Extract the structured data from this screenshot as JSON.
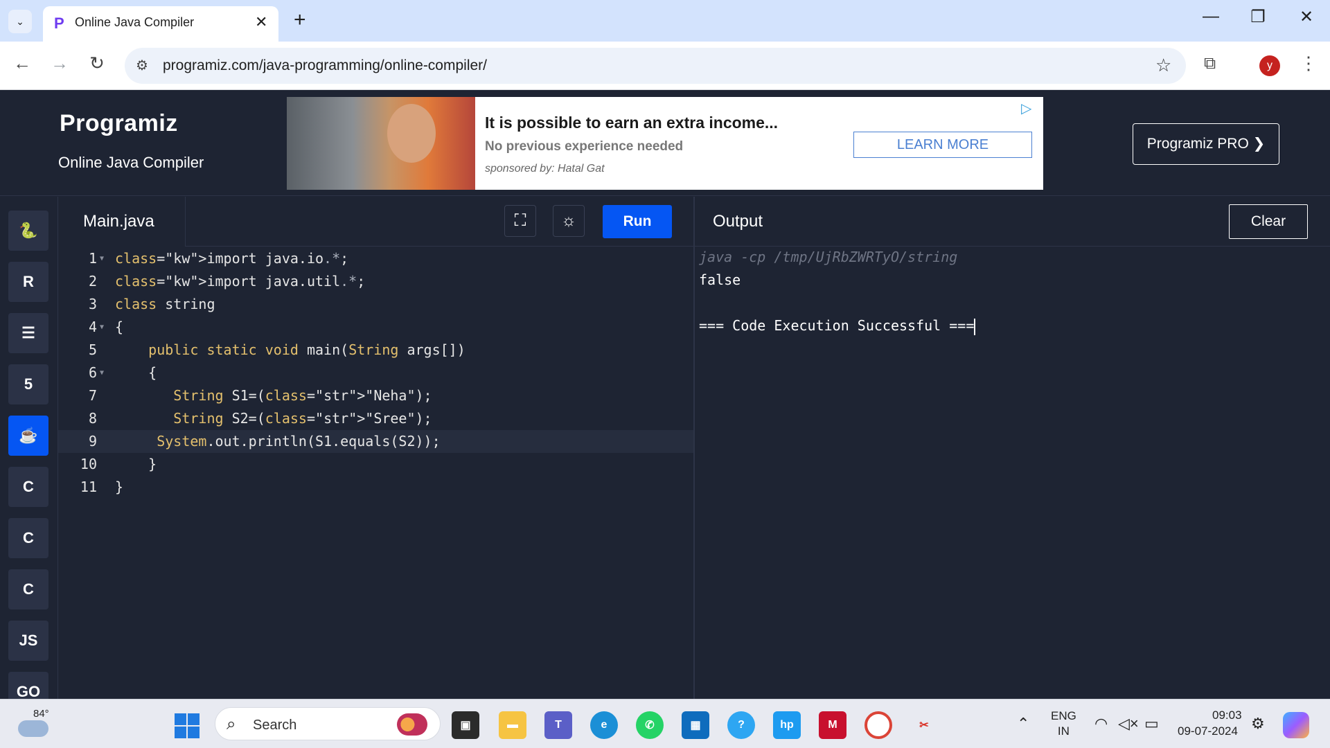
{
  "browser": {
    "tab_title": "Online Java Compiler",
    "tab_close": "✕",
    "new_tab": "+",
    "url": "programiz.com/java-programming/online-compiler/",
    "profile_initial": "y"
  },
  "header": {
    "logo": "Programiz",
    "subtitle": "Online Java Compiler",
    "pro_button": "Programiz PRO ❯"
  },
  "ad": {
    "headline": "It is possible to earn an extra income...",
    "text": "No previous experience needed",
    "sponsor": "sponsored by: Hatal Gat",
    "button": "LEARN MORE"
  },
  "sidebar": {
    "languages": [
      {
        "name": "python",
        "glyph": "🐍"
      },
      {
        "name": "r",
        "glyph": "R"
      },
      {
        "name": "sql",
        "glyph": "☰"
      },
      {
        "name": "html",
        "glyph": "5"
      },
      {
        "name": "java",
        "glyph": "☕",
        "active": true
      },
      {
        "name": "c",
        "glyph": "C"
      },
      {
        "name": "cpp",
        "glyph": "C"
      },
      {
        "name": "csharp",
        "glyph": "C"
      },
      {
        "name": "javascript",
        "glyph": "JS"
      },
      {
        "name": "go",
        "glyph": "GO"
      }
    ]
  },
  "editor": {
    "file_name": "Main.java",
    "run_label": "Run",
    "lines": [
      "import java.io.*;",
      "import java.util.*;",
      "class string",
      "{",
      "    public static void main(String args[])",
      "    {",
      "       String S1=(\"Neha\");",
      "       String S2=(\"Sree\");",
      "     System.out.println(S1.equals(S2));",
      "    }",
      "}"
    ]
  },
  "output": {
    "title": "Output",
    "clear_label": "Clear",
    "command": "java -cp /tmp/UjRbZWRTyO/string",
    "result": "false",
    "status": "=== Code Execution Successful ==="
  },
  "taskbar": {
    "temperature": "84°",
    "search_placeholder": "Search",
    "language_line1": "ENG",
    "language_line2": "IN",
    "time": "09:03",
    "date": "09-07-2024"
  }
}
